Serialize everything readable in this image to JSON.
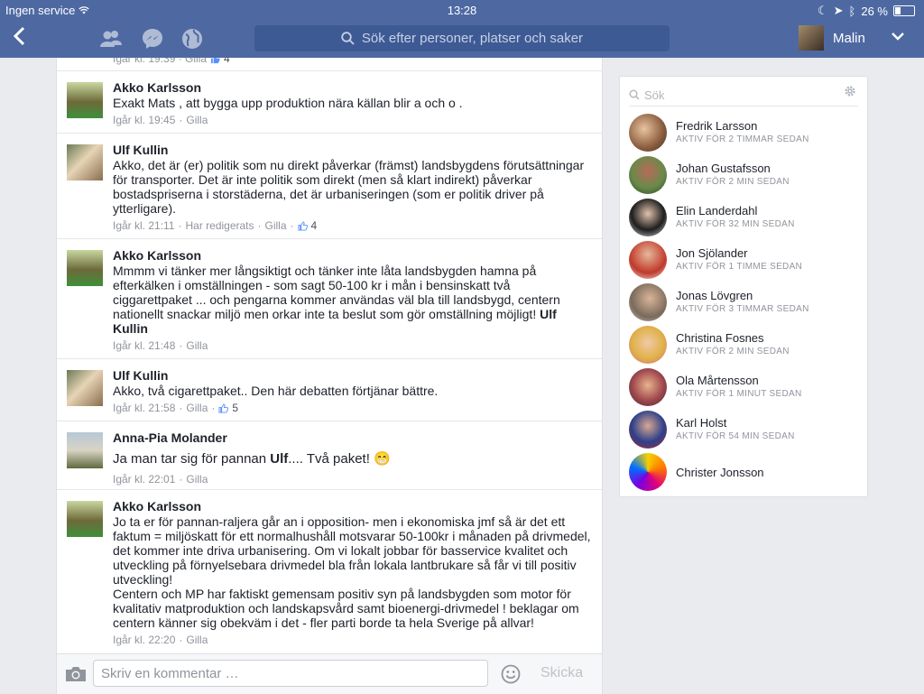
{
  "status_bar": {
    "carrier": "Ingen service",
    "time": "13:28",
    "battery": "26 %",
    "battery_level": 0.26
  },
  "nav": {
    "search_placeholder": "Sök efter personer, platser och saker",
    "user_name": "Malin"
  },
  "feed": {
    "partial_top": {
      "meta": "Igår kl. 19:39 · Gilla",
      "likes": "4"
    },
    "comments": [
      {
        "author": "Akko Karlsson",
        "text": "Exakt Mats ,  att bygga upp produktion nära källan blir a och o .",
        "time": "Igår kl. 19:45",
        "like_label": "Gilla"
      },
      {
        "author": "Ulf Kullin",
        "text": "Akko, det är (er) politik som nu direkt påverkar (främst) landsbygdens förutsättningar för transporter. Det är inte politik som direkt (men så klart indirekt) påverkar bostadspriserna i storstäderna, det är urbaniseringen (som er politik driver på ytterligare).",
        "time": "Igår kl. 21:11",
        "edited": "Har redigerats",
        "like_label": "Gilla",
        "likes": "4"
      },
      {
        "author": "Akko Karlsson",
        "text": "Mmmm vi tänker mer långsiktigt och tänker inte låta landsbygden hamna på efterkälken i omställningen - som sagt 50-100 kr i mån i bensinskatt två ciggarettpaket ... och pengarna kommer användas väl bla till landsbygd,  centern nationellt snackar miljö men orkar inte ta beslut som gör omställning möjligt! ",
        "text_bold": "Ulf Kullin",
        "time": "Igår kl. 21:48",
        "like_label": "Gilla"
      },
      {
        "author": "Ulf Kullin",
        "text": "Akko, två cigarettpaket.. Den här debatten förtjänar bättre.",
        "time": "Igår kl. 21:58",
        "like_label": "Gilla",
        "likes": "5"
      },
      {
        "author": "Anna-Pia Molander",
        "text_a": "Ja man tar sig för pannan ",
        "text_bold": "Ulf",
        "text_b": ".... Två paket! 😁",
        "time": "Igår kl. 22:01",
        "like_label": "Gilla"
      },
      {
        "author": "Akko Karlsson",
        "text": "Jo ta er för pannan-raljera går an i opposition- men i ekonomiska jmf  så är det ett faktum = miljöskatt  för ett normalhushåll motsvarar 50-100kr i månaden på drivmedel, det kommer inte driva urbanisering. Om vi lokalt jobbar för basservice kvalitet och utveckling på förnyelsebara drivmedel bla från lokala lantbrukare så får vi till  positiv utveckling!\nCentern och MP har faktiskt gemensam positiv syn på landsbygden som motor för kvalitativ matproduktion och landskapsvård samt bioenergi-drivmedel ! beklagar om centern känner sig obekväm i det - fler parti borde ta hela Sverige på allvar!",
        "time": "Igår kl. 22:20",
        "like_label": "Gilla"
      }
    ]
  },
  "composer": {
    "placeholder": "Skriv en kommentar …",
    "send_label": "Skicka"
  },
  "chat": {
    "search_placeholder": "Sök",
    "friends": [
      {
        "name": "Fredrik Larsson",
        "status": "AKTIV FÖR 2 TIMMAR SEDAN"
      },
      {
        "name": "Johan Gustafsson",
        "status": "AKTIV FÖR 2 MIN SEDAN"
      },
      {
        "name": "Elin Landerdahl",
        "status": "AKTIV FÖR 32 MIN SEDAN"
      },
      {
        "name": "Jon Sjölander",
        "status": "AKTIV FÖR 1 TIMME SEDAN"
      },
      {
        "name": "Jonas Lövgren",
        "status": "AKTIV FÖR 3 TIMMAR SEDAN"
      },
      {
        "name": "Christina Fosnes",
        "status": "AKTIV FÖR 2 MIN SEDAN"
      },
      {
        "name": "Ola Mårtensson",
        "status": "AKTIV FÖR 1 MINUT SEDAN"
      },
      {
        "name": "Karl Holst",
        "status": "AKTIV FÖR 54 MIN SEDAN"
      },
      {
        "name": "Christer Jonsson",
        "status": ""
      }
    ]
  }
}
